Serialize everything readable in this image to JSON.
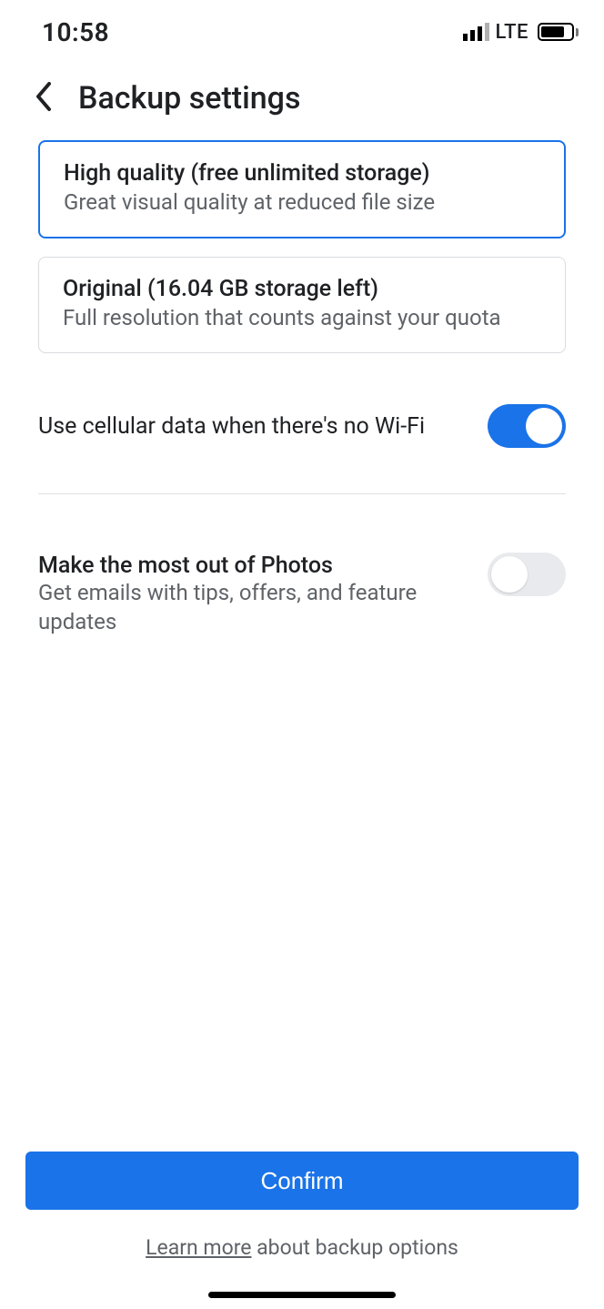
{
  "status": {
    "time": "10:58",
    "network": "LTE"
  },
  "header": {
    "title": "Backup settings"
  },
  "options": {
    "high_quality": {
      "title": "High quality (free unlimited storage)",
      "subtitle": "Great visual quality at reduced file size"
    },
    "original": {
      "title": "Original (16.04 GB storage left)",
      "subtitle": "Full resolution that counts against your quota"
    }
  },
  "cellular": {
    "label": "Use cellular data when there's no Wi-Fi",
    "enabled": true
  },
  "tips": {
    "title": "Make the most out of Photos",
    "subtitle": "Get emails with tips, offers, and feature updates",
    "enabled": false
  },
  "footer": {
    "confirm": "Confirm",
    "learn_link": "Learn more",
    "learn_rest": " about backup options"
  }
}
